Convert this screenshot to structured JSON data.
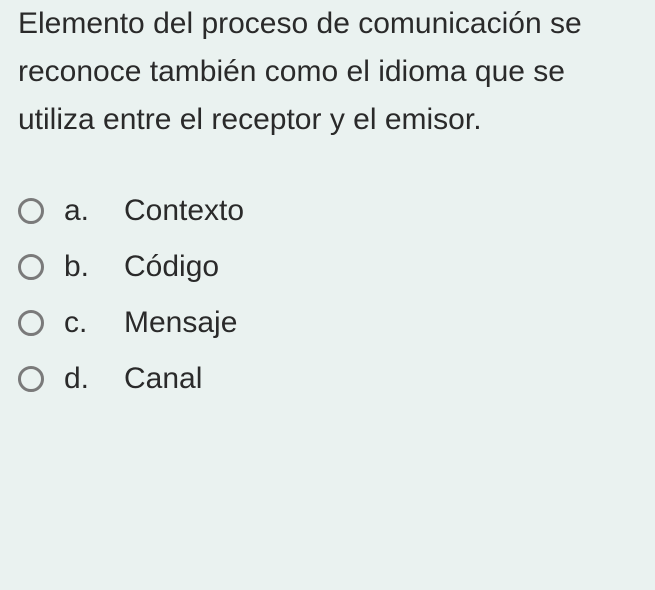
{
  "question": "Elemento del proceso de comunicación se reconoce también como el idioma que se utiliza entre el receptor y el emisor.",
  "options": [
    {
      "letter": "a.",
      "text": "Contexto"
    },
    {
      "letter": "b.",
      "text": "Código"
    },
    {
      "letter": "c.",
      "text": "Mensaje"
    },
    {
      "letter": "d.",
      "text": "Canal"
    }
  ]
}
